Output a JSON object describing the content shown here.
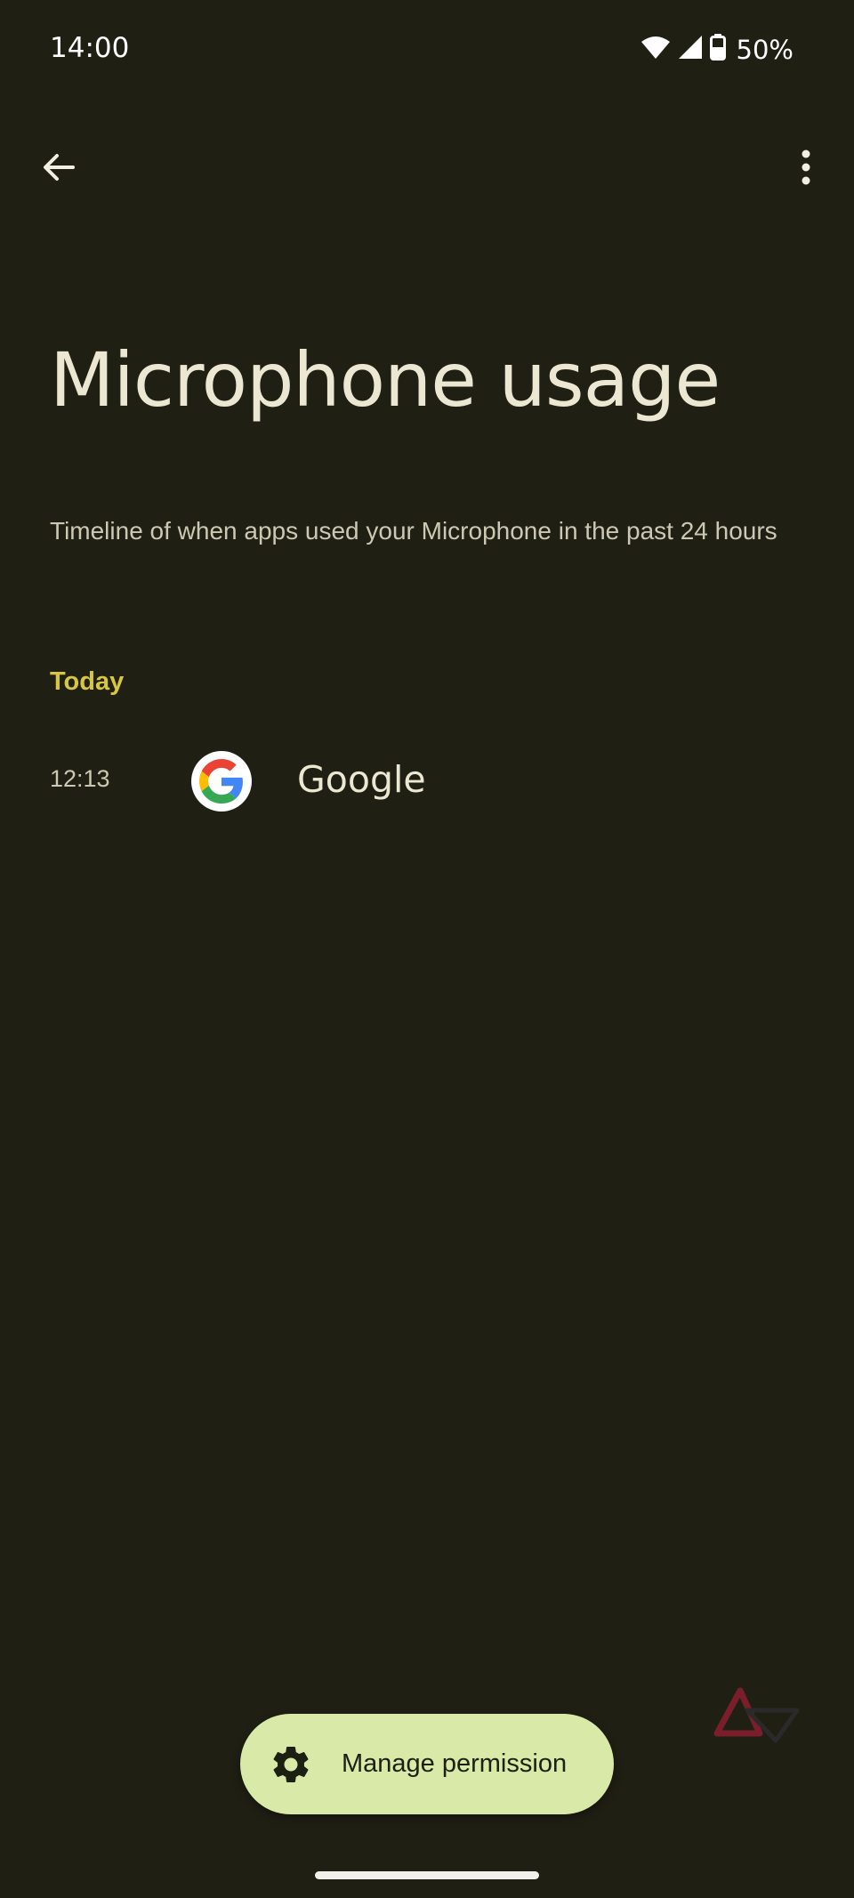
{
  "status_bar": {
    "time": "14:00",
    "battery_percent": "50%",
    "icons": [
      "wifi-icon",
      "signal-icon",
      "battery-icon"
    ]
  },
  "top_bar": {
    "back_icon": "arrow-back-icon",
    "menu_icon": "more-vert-icon"
  },
  "page": {
    "title": "Microphone usage",
    "subtitle": "Timeline of when apps used your Microphone in the past 24 hours"
  },
  "timeline": {
    "section_label": "Today",
    "entries": [
      {
        "time": "12:13",
        "app": "Google",
        "icon": "google-icon"
      }
    ]
  },
  "actions": {
    "manage_permission_label": "Manage permission",
    "manage_icon": "gear-icon"
  },
  "colors": {
    "background": "#201f14",
    "accent": "#d6c640",
    "button_bg": "#d8e9a8"
  }
}
